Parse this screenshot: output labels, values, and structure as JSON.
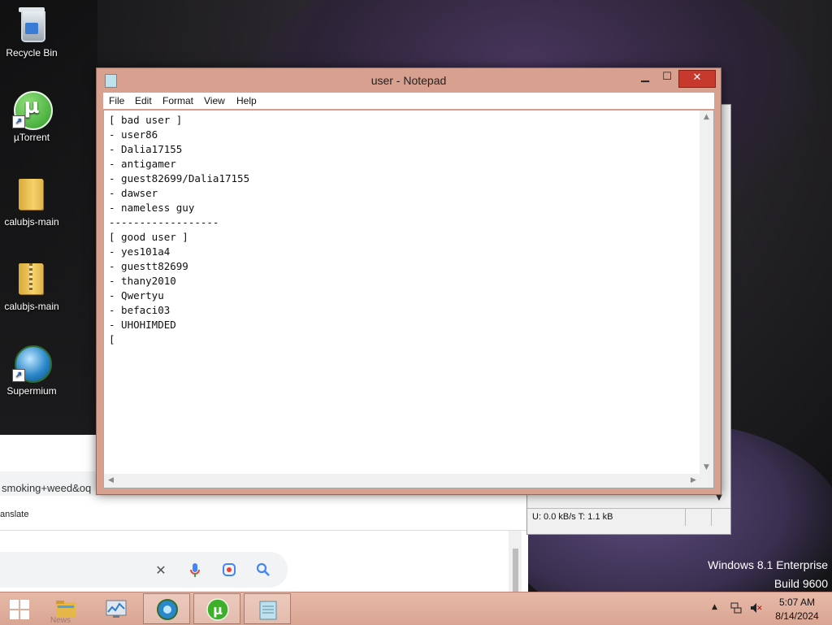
{
  "desktop": {
    "icons": [
      {
        "label": "Recycle Bin",
        "icon": "recycle-bin-icon"
      },
      {
        "label": "µTorrent",
        "icon": "utorrent-icon"
      },
      {
        "label": "calubjs-main",
        "icon": "folder-icon"
      },
      {
        "label": "calubjs-main",
        "icon": "zip-folder-icon"
      },
      {
        "label": "Supermium",
        "icon": "supermium-icon"
      }
    ],
    "watermark_line1": "Windows 8.1 Enterprise",
    "watermark_line2": "Build 9600"
  },
  "notepad": {
    "title": "user - Notepad",
    "menu": [
      "File",
      "Edit",
      "Format",
      "View",
      "Help"
    ],
    "content": "[ bad user ]\n- user86\n- Dalia17155\n- antigamer\n- guest82699/Dalia17155\n- dawser\n- nameless guy\n------------------\n[ good user ]\n- yes101a4\n- guestt82699\n- thany2010\n- Qwertyu\n- befaci03\n- UHOHIMDED\n[",
    "accent_color": "#d8a18f",
    "close_color": "#c7392c"
  },
  "background_browser": {
    "address_text": "smoking+weed&oq",
    "translate_text": "anslate",
    "search_icons": [
      "close-icon",
      "microphone-icon",
      "lens-icon",
      "search-icon"
    ]
  },
  "background_utorrent": {
    "status_text": "U: 0.0 kB/s T: 1.1 kB"
  },
  "taskbar": {
    "items": [
      {
        "icon": "start-icon",
        "label": ""
      },
      {
        "icon": "file-explorer-icon",
        "label": "News"
      },
      {
        "icon": "task-manager-icon",
        "label": ""
      },
      {
        "icon": "supermium-icon",
        "label": ""
      },
      {
        "icon": "utorrent-icon",
        "label": ""
      },
      {
        "icon": "notepad-icon",
        "label": ""
      }
    ],
    "clock_time": "5:07 AM",
    "clock_date": "8/14/2024"
  }
}
